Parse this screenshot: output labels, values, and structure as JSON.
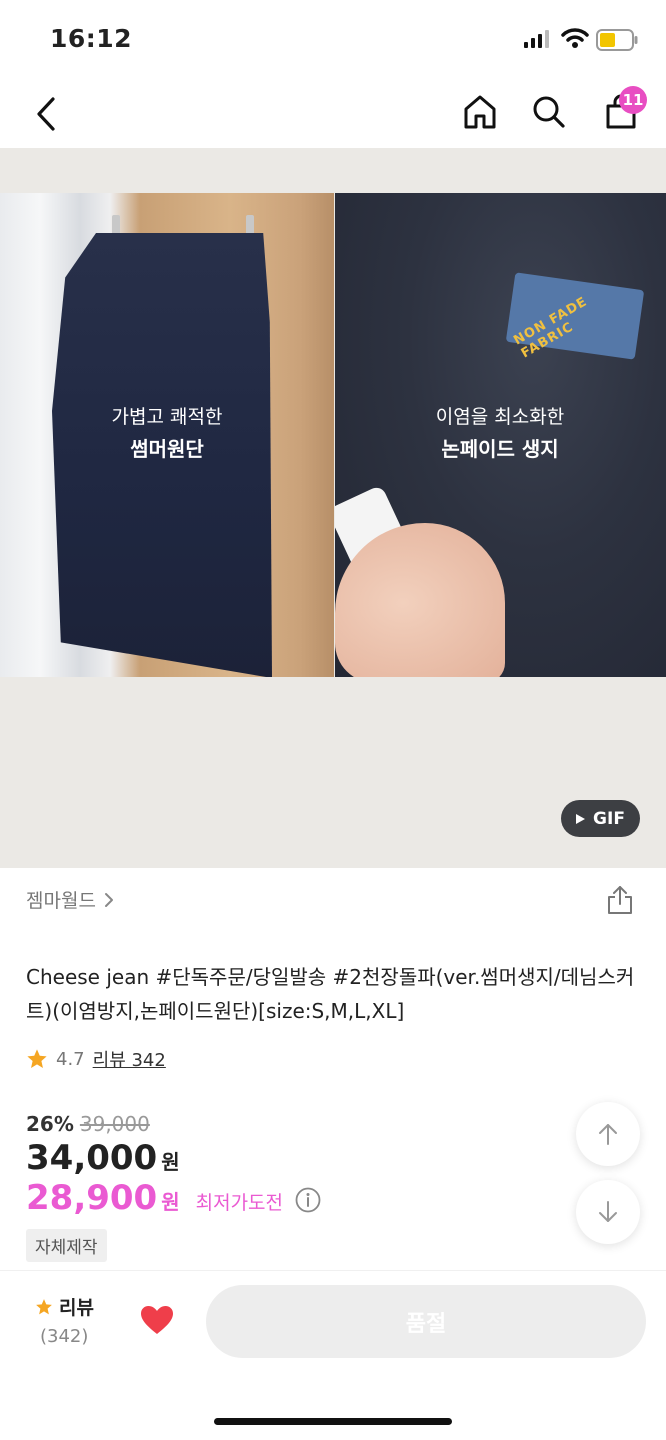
{
  "status_bar": {
    "time": "16:12"
  },
  "nav": {
    "cart_count": "11"
  },
  "hero": {
    "left_caption_line1": "가볍고 쾌적한",
    "left_caption_line2": "썸머원단",
    "right_caption_line1": "이염을 최소화한",
    "right_caption_line2": "논페이드 생지",
    "tag_text": "NON FADE FABRIC",
    "gif_label": "GIF"
  },
  "product": {
    "brand": "젬마월드",
    "title": "Cheese jean #단독주문/당일발송 #2천장돌파(ver.썸머생지/데님스커트)(이염방지,논페이드원단)[size:S,M,L,XL]",
    "rating": "4.7",
    "review_link": "리뷰 342",
    "discount_pct": "26%",
    "original_price": "39,000",
    "price": "34,000",
    "price_unit": "원",
    "best_price": "28,900",
    "best_price_unit": "원",
    "best_price_label": "최저가도전",
    "badge": "자체제작"
  },
  "bottom_bar": {
    "review_label": "리뷰",
    "review_count": "(342)",
    "soldout_label": "품절"
  },
  "colors": {
    "accent": "#ea5ad2",
    "star": "#f5a623",
    "heart": "#ef3e4a"
  }
}
